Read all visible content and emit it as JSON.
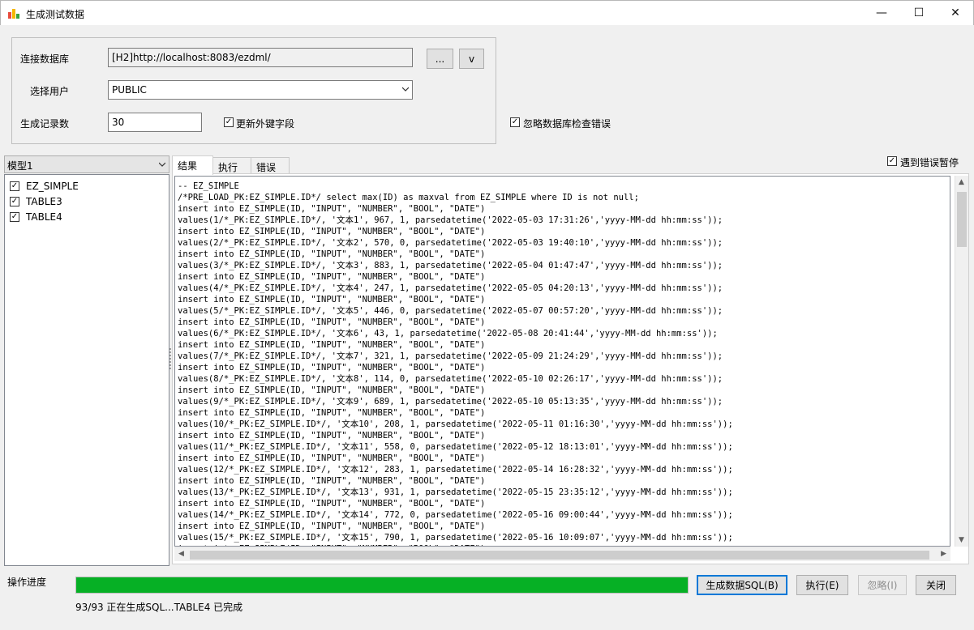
{
  "window": {
    "title": "生成测试数据",
    "minimize_glyph": "—",
    "maximize_glyph": "☐",
    "close_glyph": "✕"
  },
  "connection": {
    "db_label": "连接数据库",
    "db_value": "[H2]http://localhost:8083/ezdml/",
    "browse_label": "...",
    "dropdown_label": "v",
    "user_label": "选择用户",
    "user_value": "PUBLIC",
    "count_label": "生成记录数",
    "count_value": "30",
    "update_fk_label": "更新外键字段",
    "update_fk_checked": true,
    "ignore_db_errors_label": "忽略数据库检查错误",
    "ignore_db_errors_checked": true
  },
  "model": {
    "selected": "模型1",
    "tables": [
      {
        "name": "EZ_SIMPLE",
        "checked": true
      },
      {
        "name": "TABLE3",
        "checked": true
      },
      {
        "name": "TABLE4",
        "checked": true
      }
    ]
  },
  "tabs": [
    {
      "label": "结果",
      "active": true
    },
    {
      "label": "执行",
      "active": false
    },
    {
      "label": "错误",
      "active": false
    }
  ],
  "pause_on_error": {
    "label": "遇到错误暂停",
    "checked": true
  },
  "sql_lines": [
    "-- EZ_SIMPLE",
    "/*PRE_LOAD_PK:EZ_SIMPLE.ID*/ select max(ID) as maxval from EZ_SIMPLE where ID is not null;",
    "insert into EZ_SIMPLE(ID, \"INPUT\", \"NUMBER\", \"BOOL\", \"DATE\")",
    "values(1/*_PK:EZ_SIMPLE.ID*/, '文本1', 967, 1, parsedatetime('2022-05-03 17:31:26','yyyy-MM-dd hh:mm:ss'));",
    "insert into EZ_SIMPLE(ID, \"INPUT\", \"NUMBER\", \"BOOL\", \"DATE\")",
    "values(2/*_PK:EZ_SIMPLE.ID*/, '文本2', 570, 0, parsedatetime('2022-05-03 19:40:10','yyyy-MM-dd hh:mm:ss'));",
    "insert into EZ_SIMPLE(ID, \"INPUT\", \"NUMBER\", \"BOOL\", \"DATE\")",
    "values(3/*_PK:EZ_SIMPLE.ID*/, '文本3', 883, 1, parsedatetime('2022-05-04 01:47:47','yyyy-MM-dd hh:mm:ss'));",
    "insert into EZ_SIMPLE(ID, \"INPUT\", \"NUMBER\", \"BOOL\", \"DATE\")",
    "values(4/*_PK:EZ_SIMPLE.ID*/, '文本4', 247, 1, parsedatetime('2022-05-05 04:20:13','yyyy-MM-dd hh:mm:ss'));",
    "insert into EZ_SIMPLE(ID, \"INPUT\", \"NUMBER\", \"BOOL\", \"DATE\")",
    "values(5/*_PK:EZ_SIMPLE.ID*/, '文本5', 446, 0, parsedatetime('2022-05-07 00:57:20','yyyy-MM-dd hh:mm:ss'));",
    "insert into EZ_SIMPLE(ID, \"INPUT\", \"NUMBER\", \"BOOL\", \"DATE\")",
    "values(6/*_PK:EZ_SIMPLE.ID*/, '文本6', 43, 1, parsedatetime('2022-05-08 20:41:44','yyyy-MM-dd hh:mm:ss'));",
    "insert into EZ_SIMPLE(ID, \"INPUT\", \"NUMBER\", \"BOOL\", \"DATE\")",
    "values(7/*_PK:EZ_SIMPLE.ID*/, '文本7', 321, 1, parsedatetime('2022-05-09 21:24:29','yyyy-MM-dd hh:mm:ss'));",
    "insert into EZ_SIMPLE(ID, \"INPUT\", \"NUMBER\", \"BOOL\", \"DATE\")",
    "values(8/*_PK:EZ_SIMPLE.ID*/, '文本8', 114, 0, parsedatetime('2022-05-10 02:26:17','yyyy-MM-dd hh:mm:ss'));",
    "insert into EZ_SIMPLE(ID, \"INPUT\", \"NUMBER\", \"BOOL\", \"DATE\")",
    "values(9/*_PK:EZ_SIMPLE.ID*/, '文本9', 689, 1, parsedatetime('2022-05-10 05:13:35','yyyy-MM-dd hh:mm:ss'));",
    "insert into EZ_SIMPLE(ID, \"INPUT\", \"NUMBER\", \"BOOL\", \"DATE\")",
    "values(10/*_PK:EZ_SIMPLE.ID*/, '文本10', 208, 1, parsedatetime('2022-05-11 01:16:30','yyyy-MM-dd hh:mm:ss'));",
    "insert into EZ_SIMPLE(ID, \"INPUT\", \"NUMBER\", \"BOOL\", \"DATE\")",
    "values(11/*_PK:EZ_SIMPLE.ID*/, '文本11', 558, 0, parsedatetime('2022-05-12 18:13:01','yyyy-MM-dd hh:mm:ss'));",
    "insert into EZ_SIMPLE(ID, \"INPUT\", \"NUMBER\", \"BOOL\", \"DATE\")",
    "values(12/*_PK:EZ_SIMPLE.ID*/, '文本12', 283, 1, parsedatetime('2022-05-14 16:28:32','yyyy-MM-dd hh:mm:ss'));",
    "insert into EZ_SIMPLE(ID, \"INPUT\", \"NUMBER\", \"BOOL\", \"DATE\")",
    "values(13/*_PK:EZ_SIMPLE.ID*/, '文本13', 931, 1, parsedatetime('2022-05-15 23:35:12','yyyy-MM-dd hh:mm:ss'));",
    "insert into EZ_SIMPLE(ID, \"INPUT\", \"NUMBER\", \"BOOL\", \"DATE\")",
    "values(14/*_PK:EZ_SIMPLE.ID*/, '文本14', 772, 0, parsedatetime('2022-05-16 09:00:44','yyyy-MM-dd hh:mm:ss'));",
    "insert into EZ_SIMPLE(ID, \"INPUT\", \"NUMBER\", \"BOOL\", \"DATE\")",
    "values(15/*_PK:EZ_SIMPLE.ID*/, '文本15', 790, 1, parsedatetime('2022-05-16 10:09:07','yyyy-MM-dd hh:mm:ss'));",
    "insert into EZ_SIMPLE(ID, \"INPUT\", \"NUMBER\", \"BOOL\", \"DATE\")"
  ],
  "progress": {
    "label": "操作进度",
    "fraction": 1.0,
    "status": "93/93 正在生成SQL...TABLE4 已完成",
    "color": "#06b025"
  },
  "actions": {
    "generate_sql": "生成数据SQL(B)",
    "execute": "执行(E)",
    "ignore": "忽略(I)",
    "close": "关闭"
  }
}
